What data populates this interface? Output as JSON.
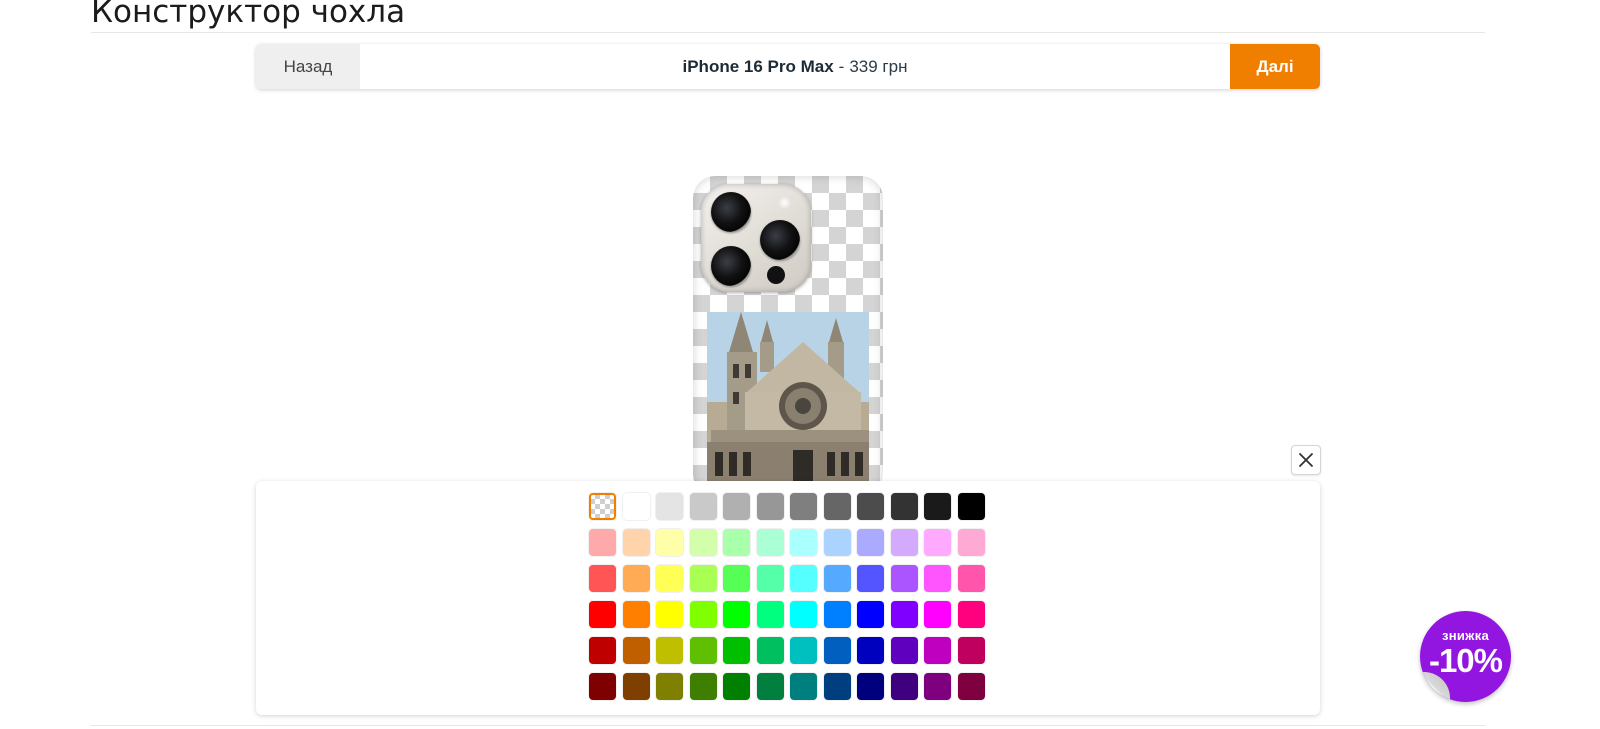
{
  "page": {
    "title": "Конструктор чохла"
  },
  "toolbar": {
    "back_label": "Назад",
    "product_name": "iPhone 16 Pro Max",
    "separator": "-",
    "price": "339 грн",
    "next_label": "Далі"
  },
  "preview": {
    "case_background": "transparent-checker",
    "image": "cathedral-photo"
  },
  "panel": {
    "close_icon": "close-icon"
  },
  "palette": {
    "selected_index": 0,
    "accent_color": "#f07f00",
    "colors": [
      "transparent",
      "#ffffff",
      "#e4e4e4",
      "#c9c9c9",
      "#b0b0b0",
      "#979797",
      "#7f7f7f",
      "#666666",
      "#4c4c4c",
      "#333333",
      "#1a1a1a",
      "#000000",
      "#ffaaaa",
      "#ffd4aa",
      "#ffffaa",
      "#d4ffaa",
      "#aaffaa",
      "#aaffd4",
      "#aaffff",
      "#aad4ff",
      "#aaaaff",
      "#d4aaff",
      "#ffaaff",
      "#ffaad4",
      "#ff5555",
      "#ffaa55",
      "#ffff55",
      "#aaff55",
      "#55ff55",
      "#55ffaa",
      "#55ffff",
      "#55aaff",
      "#5555ff",
      "#aa55ff",
      "#ff55ff",
      "#ff55aa",
      "#ff0000",
      "#ff7f00",
      "#ffff00",
      "#7fff00",
      "#00ff00",
      "#00ff7f",
      "#00ffff",
      "#007fff",
      "#0000ff",
      "#7f00ff",
      "#ff00ff",
      "#ff007f",
      "#bf0000",
      "#bf5f00",
      "#bfbf00",
      "#5fbf00",
      "#00bf00",
      "#00bf5f",
      "#00bfbf",
      "#005fbf",
      "#0000bf",
      "#5f00bf",
      "#bf00bf",
      "#bf005f",
      "#7f0000",
      "#7f3f00",
      "#7f7f00",
      "#3f7f00",
      "#007f00",
      "#007f3f",
      "#007f7f",
      "#003f7f",
      "#00007f",
      "#3f007f",
      "#7f007f",
      "#7f003f"
    ]
  },
  "promo": {
    "label": "знижка",
    "value": "-10%",
    "color": "#9315e0"
  }
}
